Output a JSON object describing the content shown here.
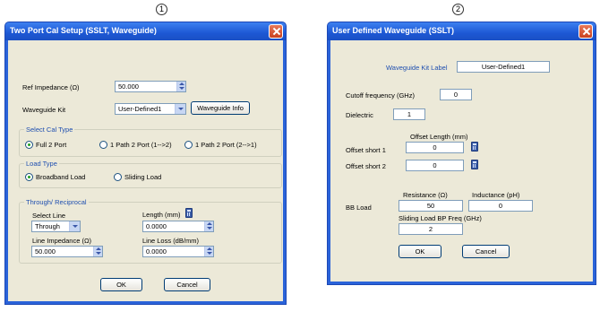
{
  "callouts": [
    "1",
    "2"
  ],
  "dialog1": {
    "title": "Two Port Cal Setup (SSLT, Waveguide)",
    "ref_impedance_label": "Ref Impedance (Ω)",
    "ref_impedance_value": "50.000",
    "waveguide_kit_label": "Waveguide  Kit",
    "waveguide_kit_value": "User-Defined1",
    "waveguide_info_button": "Waveguide Info",
    "cal_type_group": "Select Cal Type",
    "cal_types": [
      "Full 2 Port",
      "1 Path 2 Port (1-->2)",
      "1 Path 2 Port (2-->1)"
    ],
    "selected_cal_type": 0,
    "load_type_group": "Load Type",
    "load_types": [
      "Broadband Load",
      "Sliding Load"
    ],
    "selected_load_type": 0,
    "through_group": "Through/ Reciprocal",
    "select_line_label": "Select Line",
    "select_line_value": "Through",
    "length_label": "Length (mm)",
    "length_value": "0.0000",
    "line_impedance_label": "Line Impedance (Ω)",
    "line_impedance_value": "50.000",
    "line_loss_label": "Line Loss (dB/mm)",
    "line_loss_value": "0.0000",
    "ok_button": "OK",
    "cancel_button": "Cancel"
  },
  "dialog2": {
    "title": "User Defined Waveguide (SSLT)",
    "kit_label": "Waveguide Kit Label",
    "kit_value": "User-Defined1",
    "cutoff_label": "Cutoff frequency (GHz)",
    "cutoff_value": "0",
    "dielectric_label": "Dielectric",
    "dielectric_value": "1",
    "offset_length_label": "Offset Length (mm)",
    "offset_short1_label": "Offset short 1",
    "offset_short1_value": "0",
    "offset_short2_label": "Offset short 2",
    "offset_short2_value": "0",
    "bb_load_label": "BB Load",
    "resistance_label": "Resistance (Ω)",
    "resistance_value": "50",
    "inductance_label": "Inductance (pH)",
    "inductance_value": "0",
    "sliding_load_label": "Sliding Load BP Freq (GHz)",
    "sliding_load_value": "2",
    "ok_button": "OK",
    "cancel_button": "Cancel"
  },
  "colors": {
    "titlebar": "#1d58d4",
    "client": "#ece9d8",
    "group_title": "#1f4fb0",
    "close_button": "#c9411f"
  }
}
